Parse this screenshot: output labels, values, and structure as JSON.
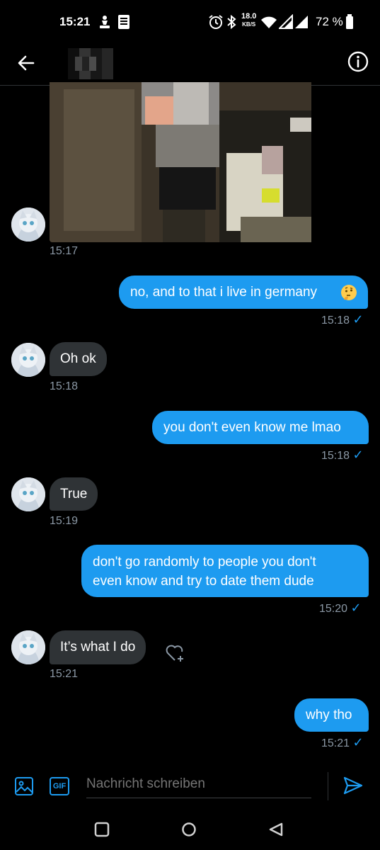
{
  "status_bar": {
    "time": "15:21",
    "net_speed_value": "18.0",
    "net_speed_unit": "KB/S",
    "battery": "72 %",
    "icons": [
      "chess-icon",
      "notes-icon",
      "alarm-icon",
      "bluetooth-icon",
      "wifi-icon",
      "signal-icon",
      "signal-icon",
      "battery-icon"
    ]
  },
  "header": {
    "back_icon": "arrow-left-icon",
    "info_icon": "info-icon"
  },
  "messages": [
    {
      "dir": "in",
      "type": "media",
      "time": "15:17"
    },
    {
      "dir": "out",
      "text": "no, and to that i live in germany",
      "emoji": "thinking-face-emoji",
      "time": "15:18",
      "status": "sent-check"
    },
    {
      "dir": "in",
      "text": "Oh ok",
      "time": "15:18"
    },
    {
      "dir": "out",
      "text": "you don't even know me lmao",
      "time": "15:18",
      "status": "sent-check"
    },
    {
      "dir": "in",
      "text": "True",
      "time": "15:19"
    },
    {
      "dir": "out",
      "text_line1": "don't go randomly to people you don't",
      "text_line2": "even know and try to date them dude",
      "time": "15:20",
      "status": "sent-check"
    },
    {
      "dir": "in",
      "text": "It’s what I do",
      "time": "15:21",
      "reaction_icon": "heart-add-icon"
    },
    {
      "dir": "out",
      "text": "why tho",
      "time": "15:21",
      "status": "sent-check"
    }
  ],
  "composer": {
    "placeholder": "Nachricht schreiben",
    "media_icon": "image-icon",
    "gif_label": "GIF",
    "send_icon": "send-icon"
  },
  "colors": {
    "accent": "#1d9bf0",
    "incoming_bubble": "#2f3336",
    "background": "#000000",
    "timestamp": "#8b98a5"
  }
}
